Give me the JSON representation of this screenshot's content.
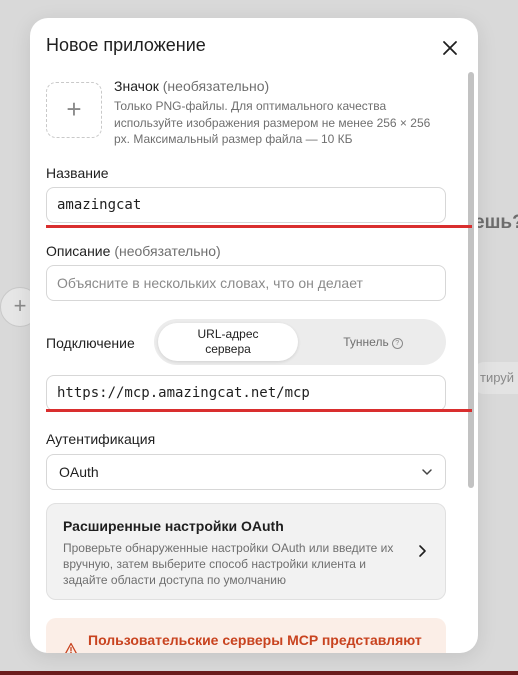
{
  "background": {
    "partial_heading": "ешь?",
    "plus_symbol": "+",
    "partial_chip": "тируй"
  },
  "dialog": {
    "title": "Новое приложение",
    "icon_field": {
      "plus_symbol": "+",
      "label": "Значок",
      "optional": "(необязательно)",
      "description": "Только PNG-файлы. Для оптимального качества используйте изображения размером не менее 256 × 256 px. Максимальный размер файла — 10 КБ"
    },
    "name_field": {
      "label": "Название",
      "value": "amazingcat"
    },
    "description_field": {
      "label": "Описание",
      "optional": "(необязательно)",
      "placeholder": "Объясните в нескольких словах, что он делает"
    },
    "connection": {
      "label": "Подключение",
      "option_active_line1": "URL-адрес",
      "option_active_line2": "сервера",
      "option_inactive": "Туннель",
      "info_symbol": "?",
      "url_value": "https://mcp.amazingcat.net/mcp"
    },
    "auth": {
      "label": "Аутентификация",
      "selected": "OAuth"
    },
    "oauth_card": {
      "title": "Расширенные настройки OAuth",
      "description": "Проверьте обнаруженные настройки OAuth или введите их вручную, затем выберите способ настройки клиента и задайте области доступа по умолчанию"
    },
    "warning": {
      "text": "Пользовательские серверы MCP представляют"
    }
  },
  "colors": {
    "annotation_red": "#d92e2e",
    "warning_text": "#c8431f",
    "warning_bg": "#fbeee7"
  }
}
